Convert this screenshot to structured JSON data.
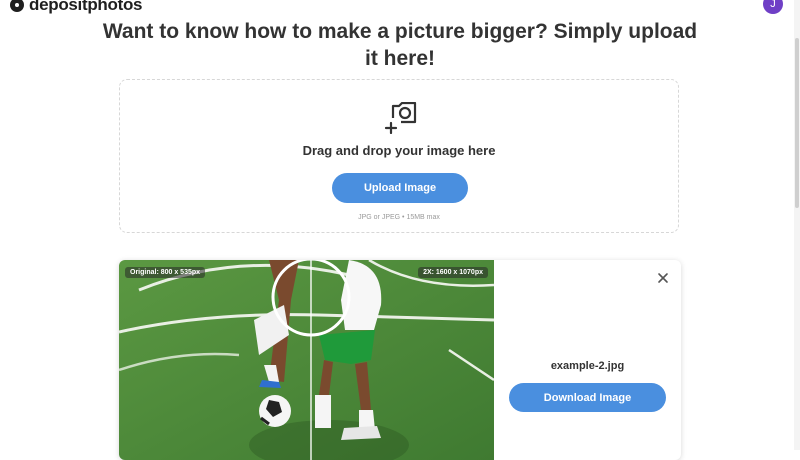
{
  "header": {
    "logo_text": "depositphotos",
    "avatar_initial": "J"
  },
  "headline": "Want to know how to make a picture bigger? Simply upload it here!",
  "dropzone": {
    "icon": "add-photo-icon",
    "title": "Drag and drop your image here",
    "upload_label": "Upload Image",
    "hint": "JPG or JPEG • 15MB max"
  },
  "result": {
    "original_label": "Original: 800 x 535px",
    "upscaled_label": "2X: 1600 x 1070px",
    "file_name": "example-2.jpg",
    "download_label": "Download Image",
    "close_icon": "close-icon"
  },
  "colors": {
    "accent": "#4a8fdf",
    "avatar": "#6f3fc6",
    "grass": "#4f8a3a",
    "shorts": "#1f9a3a"
  }
}
